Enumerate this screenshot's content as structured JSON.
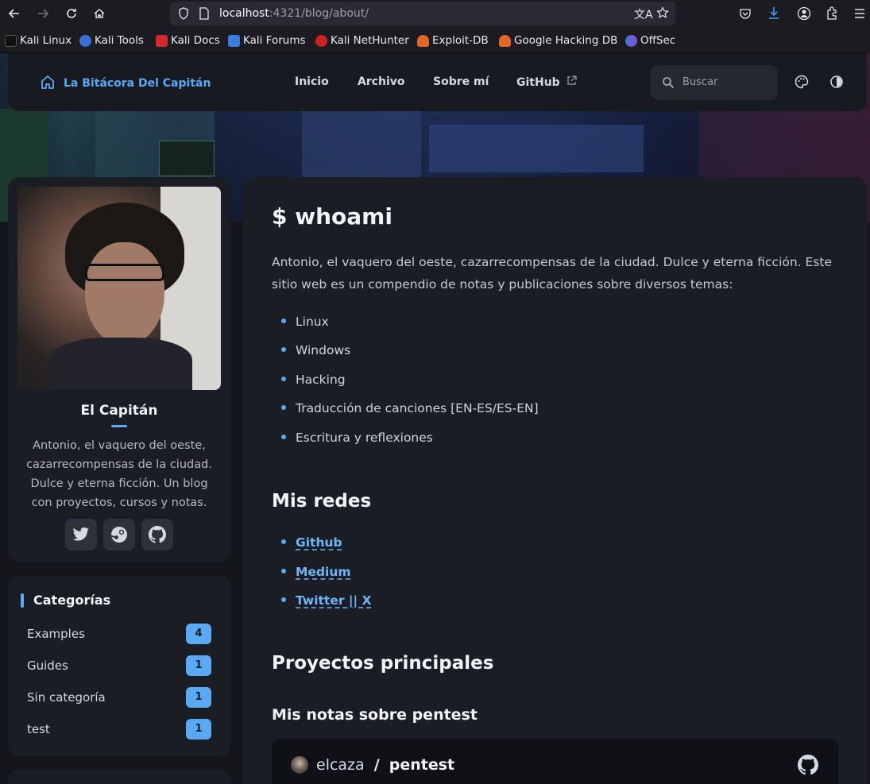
{
  "browser": {
    "url_host": "localhost",
    "url_rest": ":4321/blog/about/",
    "bookmarks": [
      "Kali Linux",
      "Kali Tools",
      "Kali Docs",
      "Kali Forums",
      "Kali NetHunter",
      "Exploit-DB",
      "Google Hacking DB",
      "OffSec"
    ]
  },
  "site": {
    "brand": "La Bitácora Del Capitán",
    "menu": [
      "Inicio",
      "Archivo",
      "Sobre mí",
      "GitHub"
    ],
    "search_placeholder": "Buscar"
  },
  "profile": {
    "name": "El Capitán",
    "bio": "Antonio, el vaquero del oeste, cazarrecompensas de la ciudad. Dulce y eterna ficción. Un blog con proyectos, cursos y notas.",
    "socials": [
      "twitter-icon",
      "steam-icon",
      "github-icon"
    ]
  },
  "categories": {
    "title": "Categorías",
    "items": [
      {
        "label": "Examples",
        "count": "4"
      },
      {
        "label": "Guides",
        "count": "1"
      },
      {
        "label": "Sin categoría",
        "count": "1"
      },
      {
        "label": "test",
        "count": "1"
      }
    ]
  },
  "content": {
    "title": "$ whoami",
    "intro": "Antonio, el vaquero del oeste, cazarrecompensas de la ciudad. Dulce y eterna ficción. Este sitio web es un compendio de notas y publicaciones sobre diversos temas:",
    "topics": [
      "Linux",
      "Windows",
      "Hacking",
      "Traducción de canciones [EN-ES/ES-EN]",
      "Escritura y reflexiones"
    ],
    "networks_title": "Mis redes",
    "networks": [
      "Github",
      "Medium",
      "Twitter || X"
    ],
    "projects_title": "Proyectos principales",
    "project_subtitle": "Mis notas sobre pentest",
    "repo_owner": "elcaza",
    "repo_sep": "/",
    "repo_name": "pentest"
  },
  "colors": {
    "accent": "#5aa9f5",
    "card": "#1a1d24",
    "background": "#14161c"
  }
}
